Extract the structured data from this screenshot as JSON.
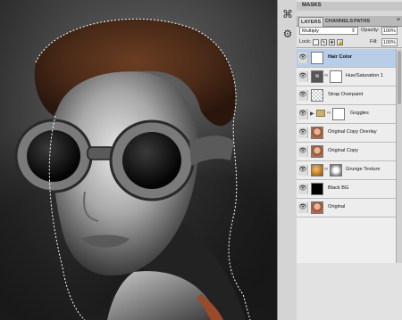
{
  "panel": {
    "masks_tab": "MASKS",
    "tabs": [
      "LAYERS",
      "CHANNELS",
      "PATHS"
    ],
    "blend_mode": "Multiply",
    "opacity_label": "Opacity:",
    "opacity_value": "100%",
    "lock_label": "Lock:",
    "fill_label": "Fill:",
    "fill_value": "100%"
  },
  "layers": [
    {
      "name": "Hair Color",
      "selected": true
    },
    {
      "name": "Hue/Saturation 1",
      "selected": false
    },
    {
      "name": "Strap Overpaint",
      "selected": false
    },
    {
      "name": "Goggles",
      "selected": false
    },
    {
      "name": "Original Copy Overlay",
      "selected": false
    },
    {
      "name": "Original Copy",
      "selected": false
    },
    {
      "name": "Grunge Texture",
      "selected": false
    },
    {
      "name": "Black BG",
      "selected": false
    },
    {
      "name": "Original",
      "selected": false
    }
  ],
  "colors": {
    "selected_layer": "#b8cde8",
    "hair": "#4a2a18"
  }
}
